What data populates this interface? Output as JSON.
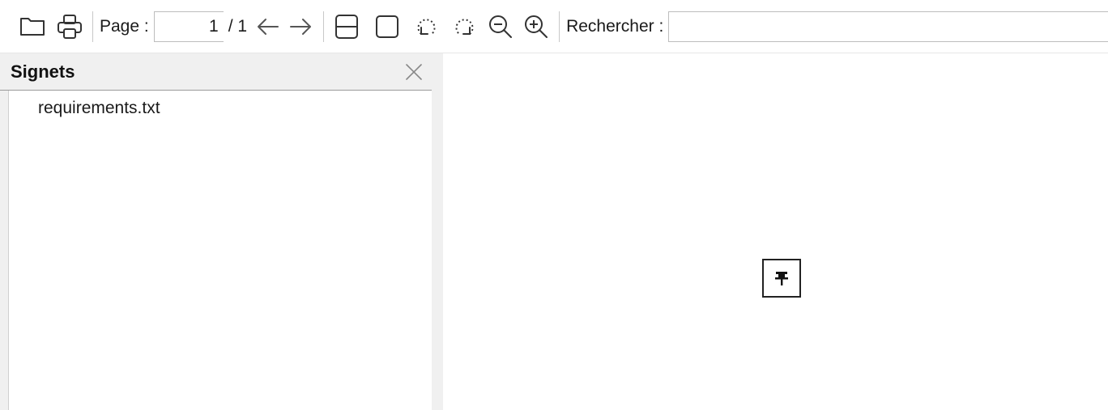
{
  "toolbar": {
    "open_icon": "folder-open-icon",
    "print_icon": "printer-icon",
    "page_label": "Page :",
    "page_value": "1",
    "page_total": "/ 1",
    "prev_icon": "arrow-left-icon",
    "next_icon": "arrow-right-icon",
    "continuous_icon": "continuous-view-icon",
    "single_page_icon": "single-page-view-icon",
    "rotate_left_icon": "rotate-left-icon",
    "rotate_right_icon": "rotate-right-icon",
    "zoom_out_icon": "zoom-out-icon",
    "zoom_in_icon": "zoom-in-icon",
    "search_label": "Rechercher :",
    "search_value": ""
  },
  "sidebar": {
    "title": "Signets",
    "close_icon": "close-icon",
    "items": [
      {
        "label": "requirements.txt"
      }
    ]
  },
  "viewer": {
    "placeholder_icon": "pushpin-icon"
  }
}
